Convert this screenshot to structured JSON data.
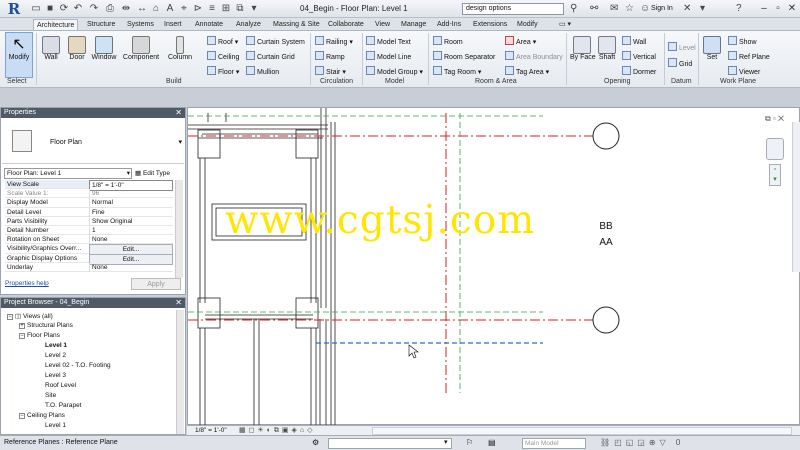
{
  "titlebar": {
    "app_menu": "R",
    "title": "04_Begin - Floor Plan: Level 1",
    "search_value": "design options",
    "sign_in": "Sign In"
  },
  "tabs": [
    {
      "label": "Architecture",
      "active": true
    },
    {
      "label": "Structure"
    },
    {
      "label": "Systems"
    },
    {
      "label": "Insert"
    },
    {
      "label": "Annotate"
    },
    {
      "label": "Analyze"
    },
    {
      "label": "Massing & Site"
    },
    {
      "label": "Collaborate"
    },
    {
      "label": "View"
    },
    {
      "label": "Manage"
    },
    {
      "label": "Add-Ins"
    },
    {
      "label": "Extensions"
    },
    {
      "label": "Modify"
    }
  ],
  "ribbon": {
    "select": {
      "modify": "Modify",
      "panel": "Select"
    },
    "build": {
      "panel": "Build",
      "wall": "Wall",
      "door": "Door",
      "window": "Window",
      "component": "Component",
      "column": "Column",
      "roof": "Roof",
      "ceiling": "Ceiling",
      "floor": "Floor",
      "curtain_system": "Curtain System",
      "curtain_grid": "Curtain Grid",
      "mullion": "Mullion"
    },
    "circulation": {
      "panel": "Circulation",
      "railing": "Railing",
      "ramp": "Ramp",
      "stair": "Stair"
    },
    "model": {
      "panel": "Model",
      "text": "Model Text",
      "line": "Model Line",
      "group": "Model Group"
    },
    "room_area": {
      "panel": "Room & Area",
      "room": "Room",
      "room_sep": "Room Separator",
      "tag_room": "Tag Room",
      "area": "Area",
      "area_boundary": "Area Boundary",
      "tag_area": "Tag Area"
    },
    "opening": {
      "panel": "Opening",
      "by_face": "By Face",
      "shaft": "Shaft",
      "wall": "Wall",
      "vertical": "Vertical",
      "dormer": "Dormer"
    },
    "datum": {
      "panel": "Datum",
      "level": "Level",
      "grid": "Grid"
    },
    "work_plane": {
      "panel": "Work Plane",
      "set": "Set",
      "show": "Show",
      "ref_plane": "Ref Plane",
      "viewer": "Viewer"
    }
  },
  "properties": {
    "title": "Properties",
    "type_name": "Floor Plan",
    "instance": "Floor Plan: Level 1",
    "edit_type": "Edit Type",
    "rows": [
      {
        "name": "View Scale",
        "value": "1/8\" = 1'-0\""
      },
      {
        "name": "Scale Value    1:",
        "value": "96"
      },
      {
        "name": "Display Model",
        "value": "Normal"
      },
      {
        "name": "Detail Level",
        "value": "Fine"
      },
      {
        "name": "Parts Visibility",
        "value": "Show Original"
      },
      {
        "name": "Detail Number",
        "value": "1"
      },
      {
        "name": "Rotation on Sheet",
        "value": "None"
      },
      {
        "name": "Visibility/Graphics Overr...",
        "value": "Edit..."
      },
      {
        "name": "Graphic Display Options",
        "value": "Edit..."
      },
      {
        "name": "Underlay",
        "value": "None"
      }
    ],
    "help_link": "Properties help",
    "apply": "Apply"
  },
  "browser": {
    "title": "Project Browser - 04_Begin",
    "items": [
      {
        "label": "Views (all)",
        "level": 0,
        "expander": "−"
      },
      {
        "label": "Structural Plans",
        "level": 1,
        "expander": "+"
      },
      {
        "label": "Floor Plans",
        "level": 1,
        "expander": "−"
      },
      {
        "label": "Level 1",
        "level": 2,
        "bold": true
      },
      {
        "label": "Level 2",
        "level": 2
      },
      {
        "label": "Level 02 - T.O. Footing",
        "level": 2
      },
      {
        "label": "Level 3",
        "level": 2
      },
      {
        "label": "Roof Level",
        "level": 2
      },
      {
        "label": "Site",
        "level": 2
      },
      {
        "label": "T.O. Parapet",
        "level": 2
      },
      {
        "label": "Ceiling Plans",
        "level": 1,
        "expander": "−"
      },
      {
        "label": "Level 1",
        "level": 2
      }
    ]
  },
  "canvas": {
    "grid_labels": [
      "AA",
      "BB"
    ],
    "watermark": "www.cgtsj.com"
  },
  "viewbar": {
    "scale": "1/8\" = 1'-0\""
  },
  "status": {
    "text": "Reference Planes : Reference Plane",
    "model": "Main Model"
  },
  "colors": {
    "grid_red": "#d81f1f",
    "grid_green": "#2ea44f",
    "ref_blue": "#2a6fc2",
    "watermark": "#ffe600"
  }
}
